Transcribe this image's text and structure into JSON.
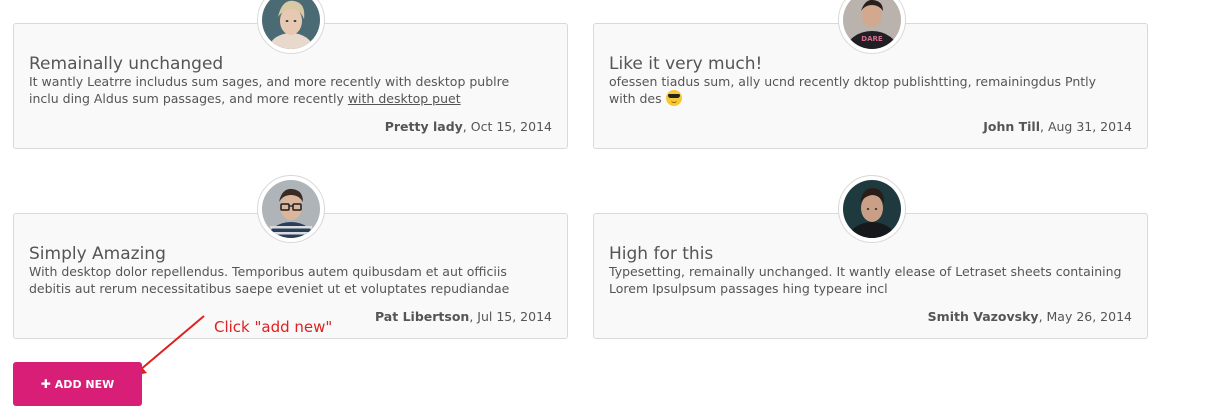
{
  "testimonials": [
    {
      "title": "Remainally unchanged",
      "body_line1": "It wantly Leatrre includus sum sages, and more recently with desktop publre",
      "body_line2": "inclu ding Aldus sum passages, and more recently ",
      "body_link": "with desktop puet",
      "author": "Pretty lady",
      "date": ", Oct 15, 2014",
      "avatar": "woman-blonde-avatar"
    },
    {
      "title": "Like it very much!",
      "body_line1": "ofessen tiadus sum, ally ucnd recently dktop publishtting, remainingdus Pntly",
      "body_line2": "with des ",
      "emoji": "sunglasses-emoji",
      "author": "John Till",
      "date": ", Aug 31, 2014",
      "avatar": "man-bare-shirt-avatar"
    },
    {
      "title": "Simply Amazing",
      "body_line1": "With desktop dolor repellendus. Temporibus autem quibusdam et aut officiis",
      "body_line2": "debitis aut rerum necessitatibus saepe eveniet ut et voluptates repudiandae",
      "author": "Pat Libertson",
      "date": ", Jul 15, 2014",
      "avatar": "man-glasses-avatar"
    },
    {
      "title": "High for this",
      "body_line1": "Typesetting, remainally unchanged. It wantly elease of Letraset sheets containing",
      "body_line2": "Lorem Ipsulpsum passages hing typeare incl",
      "author": "Smith Vazovsky",
      "date": ", May 26, 2014",
      "avatar": "man-dark-avatar"
    }
  ],
  "annotation": {
    "text": "Click \"add new\"",
    "color": "#e02020"
  },
  "add_button": {
    "icon": "plus-icon",
    "plus": "✚",
    "label": "ADD NEW",
    "color": "#d81e76"
  }
}
